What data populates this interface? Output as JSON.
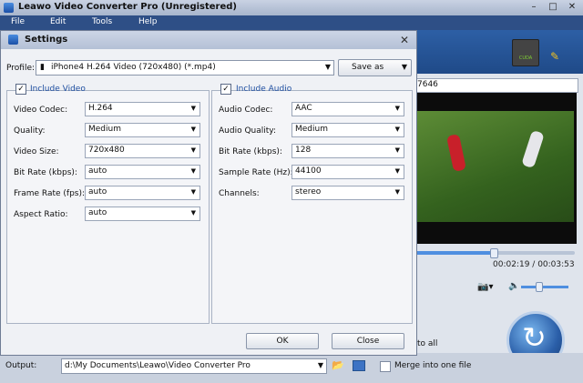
{
  "app": {
    "title": "Leawo Video Converter Pro (Unregistered)",
    "menu": [
      "File",
      "Edit",
      "Tools",
      "Help"
    ],
    "window_buttons": {
      "minimize": "–",
      "restore": "□",
      "close": "✕"
    }
  },
  "right_panel": {
    "file_name_fragment": "7646",
    "time_current": "00:02:19",
    "time_sep": " / ",
    "time_total": "00:03:53",
    "seek_progress": 0.49,
    "volume_level": 0.75,
    "apply_to_all_fragment": "to all",
    "nvidia_label": "CUDA"
  },
  "output": {
    "label": "Output:",
    "path": "d:\\My Documents\\Leawo\\Video Converter Pro",
    "merge_label": "Merge into one file",
    "merge_checked": false
  },
  "dialog": {
    "title": "Settings",
    "close_glyph": "✕",
    "profile_label": "Profile:",
    "profile_value": "iPhone4 H.264 Video (720x480) (*.mp4)",
    "save_as_label": "Save as",
    "dropdown_glyph": "▼",
    "video": {
      "header": "Include Video",
      "checked": true,
      "rows": [
        {
          "label": "Video Codec:",
          "value": "H.264"
        },
        {
          "label": "Quality:",
          "value": "Medium"
        },
        {
          "label": "Video Size:",
          "value": "720x480"
        },
        {
          "label": "Bit Rate (kbps):",
          "value": "auto"
        },
        {
          "label": "Frame Rate (fps):",
          "value": "auto"
        },
        {
          "label": "Aspect Ratio:",
          "value": "auto"
        }
      ]
    },
    "audio": {
      "header": "Include Audio",
      "checked": true,
      "rows": [
        {
          "label": "Audio Codec:",
          "value": "AAC"
        },
        {
          "label": "Audio Quality:",
          "value": "Medium"
        },
        {
          "label": "Bit Rate (kbps):",
          "value": "128"
        },
        {
          "label": "Sample Rate (Hz):",
          "value": "44100"
        },
        {
          "label": "Channels:",
          "value": "stereo"
        }
      ]
    },
    "ok_label": "OK",
    "close_label": "Close"
  },
  "colors": {
    "accent": "#2e4f86",
    "group_header": "#1f4fa0"
  }
}
